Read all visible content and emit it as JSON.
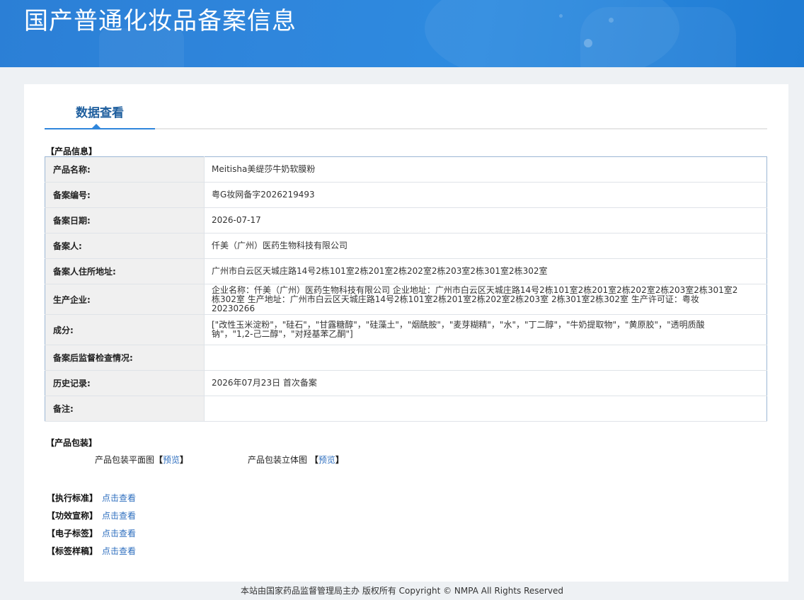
{
  "header": {
    "title": "国产普通化妆品备案信息"
  },
  "tabs": [
    {
      "label": "数据查看"
    }
  ],
  "product_info": {
    "section_label": "【产品信息】",
    "rows": [
      {
        "key": "产品名称:",
        "value": "Meitisha美缇莎牛奶软膜粉"
      },
      {
        "key": "备案编号:",
        "value": "粤G妆网备字2026219493"
      },
      {
        "key": "备案日期:",
        "value": "2026-07-17"
      },
      {
        "key": "备案人:",
        "value": "仟美（广州）医药生物科技有限公司"
      },
      {
        "key": "备案人住所地址:",
        "value": "广州市白云区天城庄路14号2栋101室2栋201室2栋202室2栋203室2栋301室2栋302室"
      },
      {
        "key": "生产企业:",
        "value": "企业名称：仟美（广州）医药生物科技有限公司 企业地址：广州市白云区天城庄路14号2栋101室2栋201室2栋202室2栋203室2栋301室2栋302室 生产地址：广州市白云区天城庄路14号2栋101室2栋201室2栋202室2栋203室 2栋301室2栋302室 生产许可证：粤妆20230266"
      },
      {
        "key": "成分:",
        "value": "[\"改性玉米淀粉\"，\"硅石\"，\"甘露糖醇\"，\"硅藻土\"，\"烟酰胺\"，\"麦芽糊精\"，\"水\"，\"丁二醇\"，\"牛奶提取物\"，\"黄原胶\"，\"透明质酸钠\"，\"1,2-己二醇\"，\"对羟基苯乙酮\"]"
      },
      {
        "key": "备案后监督检查情况:",
        "value": ""
      },
      {
        "key": "历史记录:",
        "value": "2026年07月23日 首次备案"
      },
      {
        "key": "备注:",
        "value": ""
      }
    ]
  },
  "packaging": {
    "section_label": "【产品包装】",
    "flat": {
      "label": "产品包装平面图",
      "bracket_open": "【",
      "link": "预览",
      "bracket_close": "】"
    },
    "solid": {
      "label": "产品包装立体图",
      "bracket_open": "【",
      "link": "预览",
      "bracket_close": "】"
    }
  },
  "links": [
    {
      "label": "【执行标准】",
      "link": "点击查看"
    },
    {
      "label": "【功效宣称】",
      "link": "点击查看"
    },
    {
      "label": "【电子标签】",
      "link": "点击查看"
    },
    {
      "label": "【标签样稿】",
      "link": "点击查看"
    }
  ],
  "footer": {
    "text": "本站由国家药品监督管理局主办 版权所有 Copyright © NMPA All Rights Reserved"
  }
}
